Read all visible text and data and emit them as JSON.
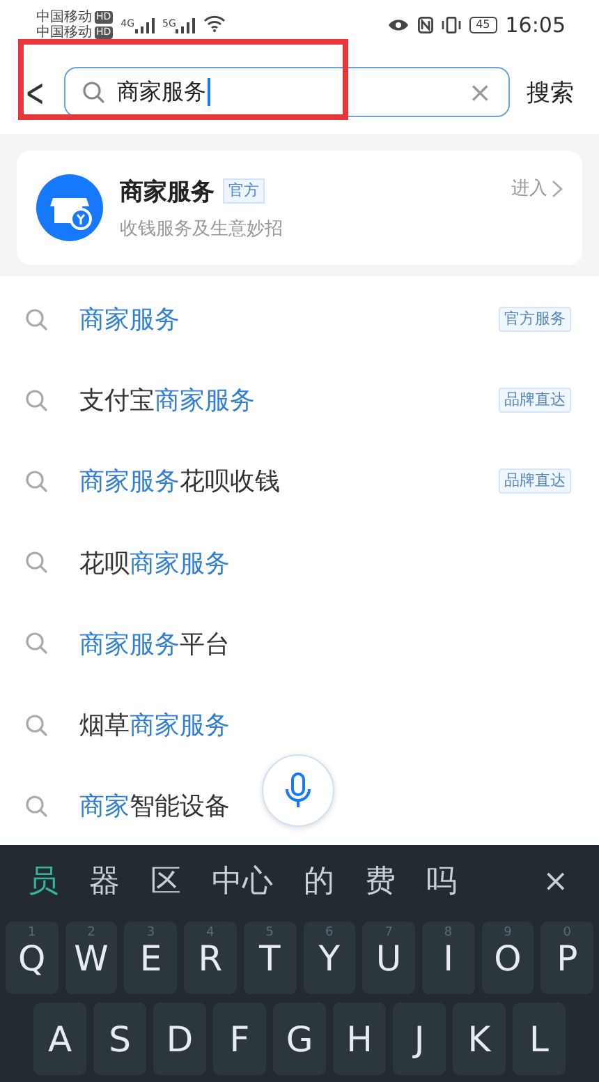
{
  "status_bar": {
    "carriers": [
      {
        "name": "中国移动",
        "badge": "HD"
      },
      {
        "name": "中国移动",
        "badge": "HD"
      }
    ],
    "signals": [
      "4G",
      "5G"
    ],
    "battery": "45",
    "time": "16:05"
  },
  "search": {
    "back": "<",
    "value": "商家服务",
    "clear": "×",
    "submit": "搜索",
    "annotated": true
  },
  "app_card": {
    "name": "商家服务",
    "tag": "官方",
    "subtitle": "收钱服务及生意妙招",
    "action": "进入"
  },
  "suggestions": [
    {
      "parts": [
        {
          "text": "商家服务",
          "highlight": true
        }
      ],
      "tag": "官方服务"
    },
    {
      "parts": [
        {
          "text": "支付宝",
          "highlight": false
        },
        {
          "text": "商家服务",
          "highlight": true
        }
      ],
      "tag": "品牌直达"
    },
    {
      "parts": [
        {
          "text": "商家服务",
          "highlight": true
        },
        {
          "text": "花呗收钱",
          "highlight": false
        }
      ],
      "tag": "品牌直达"
    },
    {
      "parts": [
        {
          "text": "花呗",
          "highlight": false
        },
        {
          "text": "商家服务",
          "highlight": true
        }
      ]
    },
    {
      "parts": [
        {
          "text": "商家服务",
          "highlight": true
        },
        {
          "text": "平台",
          "highlight": false
        }
      ]
    },
    {
      "parts": [
        {
          "text": "烟草",
          "highlight": false
        },
        {
          "text": "商家服务",
          "highlight": true
        }
      ]
    },
    {
      "parts": [
        {
          "text": "商家",
          "highlight": true
        },
        {
          "text": "智能设备",
          "highlight": false
        }
      ]
    }
  ],
  "keyboard": {
    "candidates": [
      {
        "text": "员",
        "selected": true
      },
      {
        "text": "器",
        "selected": false
      },
      {
        "text": "区",
        "selected": false
      },
      {
        "text": "中心",
        "selected": false
      },
      {
        "text": "的",
        "selected": false
      },
      {
        "text": "费",
        "selected": false
      },
      {
        "text": "吗",
        "selected": false
      }
    ],
    "close": "×",
    "rows": [
      [
        {
          "key": "Q",
          "hint": "1"
        },
        {
          "key": "W",
          "hint": "2"
        },
        {
          "key": "E",
          "hint": "3"
        },
        {
          "key": "R",
          "hint": "4"
        },
        {
          "key": "T",
          "hint": "5"
        },
        {
          "key": "Y",
          "hint": "6"
        },
        {
          "key": "U",
          "hint": "7"
        },
        {
          "key": "I",
          "hint": "8"
        },
        {
          "key": "O",
          "hint": "9"
        },
        {
          "key": "P",
          "hint": "0"
        }
      ],
      [
        {
          "key": "A"
        },
        {
          "key": "S"
        },
        {
          "key": "D"
        },
        {
          "key": "F"
        },
        {
          "key": "G"
        },
        {
          "key": "H"
        },
        {
          "key": "J"
        },
        {
          "key": "K"
        },
        {
          "key": "L"
        }
      ]
    ]
  }
}
